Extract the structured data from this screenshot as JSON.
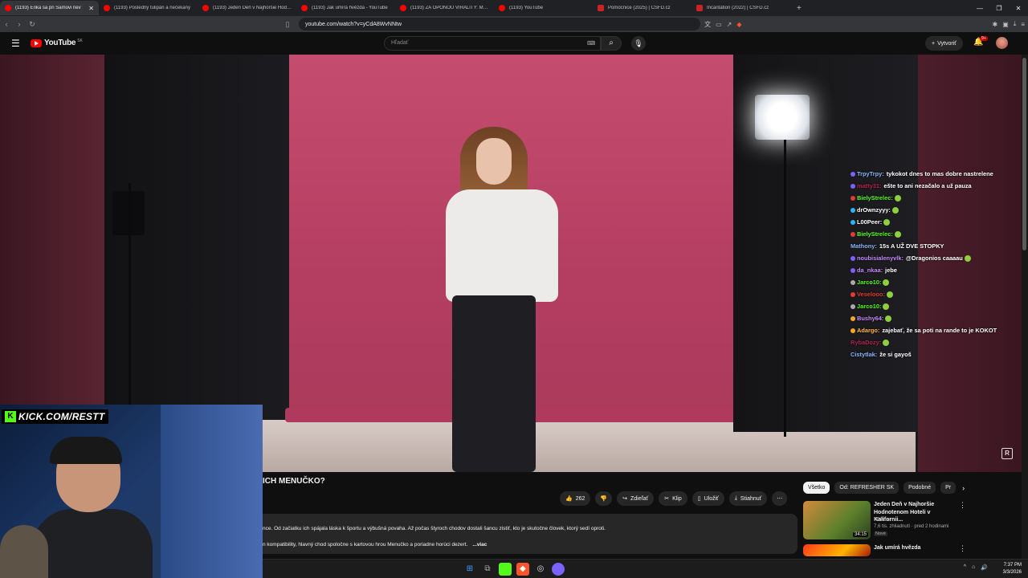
{
  "browser": {
    "tabs": [
      {
        "label": "(1193) Erika sa pri Samovi nev",
        "active": true,
        "favicon": "youtube"
      },
      {
        "label": "(1193) Posledný tulipán a nečekaný",
        "active": false,
        "favicon": "youtube"
      },
      {
        "label": "(1193) Jeden Deň v Najhoršie Hodno",
        "active": false,
        "favicon": "youtube"
      },
      {
        "label": "(1193) Jak umírá hvězda - YouTube",
        "active": false,
        "favicon": "youtube"
      },
      {
        "label": "(1193) ZA OPONOU VIRALITY: MELT",
        "active": false,
        "favicon": "youtube"
      },
      {
        "label": "(1193) YouTube",
        "active": false,
        "favicon": "youtube"
      },
      {
        "label": "Pomocnice (2025) | ČSFD.cz",
        "active": false,
        "favicon": "csfd"
      },
      {
        "label": "Incantation (2022) | ČSFD.cz",
        "active": false,
        "favicon": "csfd"
      }
    ],
    "url": "youtube.com/watch?v=yCdA8WvNNtw"
  },
  "youtube": {
    "logo_text": "YouTube",
    "region": "SK",
    "search_placeholder": "Hľadať",
    "create_label": "Vytvoriť",
    "notification_count": "9+"
  },
  "video": {
    "title_visible": "ICH MENUČKO?",
    "likes": "262",
    "share_label": "Zdieľať",
    "clip_label": "Klip",
    "save_label": "Uložiť",
    "download_label": "Stiahnuť",
    "description_line1": "nce. Od začiatku ich spájala láska k športu a výbušná povaha. Až počas štyroch chodov dostali šancu zistiť, kto je skutočne človek, ktorý sedí oproti.",
    "description_line2": "n kompatibility, hlavný chod spoločne s kartovou hrou Menučko a poriadne horúci dezert.",
    "more_label": "...viac"
  },
  "overlay": {
    "kick_url": "KICK.COM/RESTT"
  },
  "chat": [
    {
      "user": "TrpyTrpy:",
      "text": "tykokot dnes to mas dobre nastrelene",
      "color": "#8ab4f8",
      "badge": "#7b61ff"
    },
    {
      "user": "matty31:",
      "text": "ešte to ani nezačalo a už pauza",
      "color": "#b2224d",
      "badge": "#7b61ff"
    },
    {
      "user": "BielyStrelec:",
      "text": "",
      "color": "#53fc18",
      "badge": "#e53935",
      "emote": true
    },
    {
      "user": "drOwnzyyy:",
      "text": "",
      "color": "#ffffff",
      "badge": "#29b6f6",
      "emote": true
    },
    {
      "user": "L00Peer:",
      "text": "",
      "color": "#ffffff",
      "badge": "#29b6f6",
      "emote": true
    },
    {
      "user": "BielyStrelec:",
      "text": "",
      "color": "#53fc18",
      "badge": "#e53935",
      "emote": true
    },
    {
      "user": "Mathony:",
      "text": "15s A UŽ DVE STOPKY",
      "color": "#8ab4f8",
      "badge": "",
      "emote": false
    },
    {
      "user": "noubisialenyvlk:",
      "text": "@Dragonios caaaau",
      "color": "#c58af9",
      "badge": "#7b61ff",
      "emote": true
    },
    {
      "user": "da_nkaa:",
      "text": "jebe",
      "color": "#c58af9",
      "badge": "#7b61ff"
    },
    {
      "user": "Jarco10:",
      "text": "",
      "color": "#53fc18",
      "badge": "#aaaaaa",
      "emote": true
    },
    {
      "user": "Veselooo:",
      "text": "",
      "color": "#e53935",
      "badge": "#e53935",
      "emote": true
    },
    {
      "user": "Jarco10:",
      "text": "",
      "color": "#53fc18",
      "badge": "#aaaaaa",
      "emote": true
    },
    {
      "user": "Bushy64:",
      "text": "",
      "color": "#c58af9",
      "badge": "#f9a825",
      "emote": true
    },
    {
      "user": "Adargo:",
      "text": "zajebať, že sa poti na rande to je KOKOT",
      "color": "#ffb74d",
      "badge": "#f9a825"
    },
    {
      "user": "RybaDozy:",
      "text": "",
      "color": "#b2224d",
      "badge": "",
      "emote": true
    },
    {
      "user": "Cistytlak:",
      "text": "že si gayoš",
      "color": "#8ab4f8",
      "badge": ""
    }
  ],
  "recommendations": {
    "chips": [
      "Všetko",
      "Od: REFRESHER SK",
      "Podobné",
      "Pr"
    ],
    "items": [
      {
        "title": "Jeden Deň v Najhoršie Hodnotenom Hoteli v Kalifornii...",
        "channel": "PPPiter",
        "meta": "7,6 tis. zhliadnutí · pred 2 hodinami",
        "badge": "Nové",
        "duration": "34:15"
      },
      {
        "title": "Jak umírá hvězda",
        "channel": "",
        "meta": "",
        "badge": "",
        "duration": ""
      }
    ]
  },
  "taskbar": {
    "time": "7:37 PM",
    "date": "3/3/2026"
  }
}
